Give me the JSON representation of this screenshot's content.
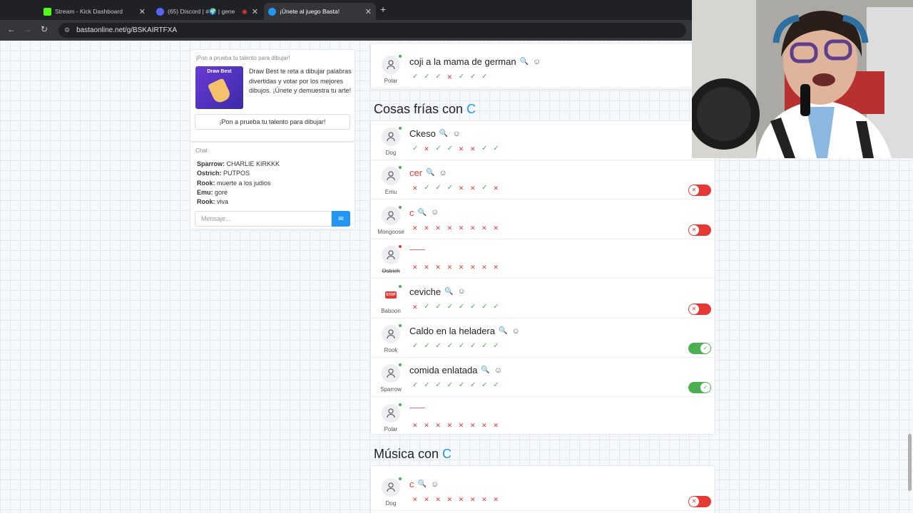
{
  "browser": {
    "tabs": [
      {
        "label": "Stream - Kick Dashboard",
        "favicon_color": "#53fc18"
      },
      {
        "label": "(65) Discord | #🌍 | gene",
        "favicon_color": "#5865f2"
      },
      {
        "label": "¡Únete al juego Basta!",
        "favicon_color": "#2196f3"
      }
    ],
    "url": "bastaonline.net/g/BSKAIRTFXA"
  },
  "promo": {
    "title": "¡Pon a prueba tu talento para dibujar!",
    "image_text": "Draw Best",
    "description": "Draw Best te reta a dibujar palabras divertidas y votar por los mejores dibujos. ¡Únete y demuestra tu arte!",
    "button": "¡Pon a prueba tu talento para dibujar!"
  },
  "chat": {
    "title": "Chat",
    "messages": [
      {
        "user": "Sparrow:",
        "text": "CHARLIE KIRKKK"
      },
      {
        "user": "Ostrich:",
        "text": "PUTPOS"
      },
      {
        "user": "Rook:",
        "text": "muerte a los judios"
      },
      {
        "user": "Emu:",
        "text": "gore"
      },
      {
        "user": "Rook:",
        "text": "viva"
      }
    ],
    "placeholder": "Mensaje..."
  },
  "game": {
    "top_row": {
      "player": "Polar",
      "answer": "coji a la mama de german",
      "votes": [
        "ok",
        "ok",
        "ok",
        "no",
        "ok",
        "ok",
        "ok"
      ]
    },
    "category1": {
      "title": "Cosas frías con ",
      "letter": "C",
      "rows": [
        {
          "player": "Dog",
          "answer": "Ckeso",
          "votes": [
            "ok",
            "no",
            "ok",
            "ok",
            "no",
            "no",
            "ok",
            "ok"
          ]
        },
        {
          "player": "Emu",
          "answer": "cer",
          "votes": [
            "no",
            "ok",
            "ok",
            "ok",
            "no",
            "no",
            "ok",
            "no"
          ]
        },
        {
          "player": "Mongoose",
          "answer": "c",
          "votes": [
            "no",
            "no",
            "no",
            "no",
            "no",
            "no",
            "no",
            "no"
          ]
        },
        {
          "player": "Ostrich",
          "answer": "",
          "votes": [
            "no",
            "no",
            "no",
            "no",
            "no",
            "no",
            "no",
            "no"
          ]
        },
        {
          "player": "Baboon",
          "answer": "ceviche",
          "votes": [
            "no",
            "ok",
            "ok",
            "ok",
            "ok",
            "ok",
            "ok",
            "ok"
          ]
        },
        {
          "player": "Rook",
          "answer": "Caldo en la heladera",
          "votes": [
            "ok",
            "ok",
            "ok",
            "ok",
            "ok",
            "ok",
            "ok",
            "ok"
          ]
        },
        {
          "player": "Sparrow",
          "answer": "comida enlatada",
          "votes": [
            "ok",
            "ok",
            "ok",
            "ok",
            "ok",
            "ok",
            "ok",
            "ok"
          ]
        },
        {
          "player": "Polar",
          "answer": "",
          "votes": [
            "no",
            "no",
            "no",
            "no",
            "no",
            "no",
            "no",
            "no"
          ]
        }
      ]
    },
    "category2": {
      "title": "Música con ",
      "letter": "C",
      "rows": [
        {
          "player": "Dog",
          "answer": "c",
          "votes": [
            "no",
            "no",
            "no",
            "no",
            "no",
            "no",
            "no",
            "no"
          ]
        }
      ]
    }
  }
}
